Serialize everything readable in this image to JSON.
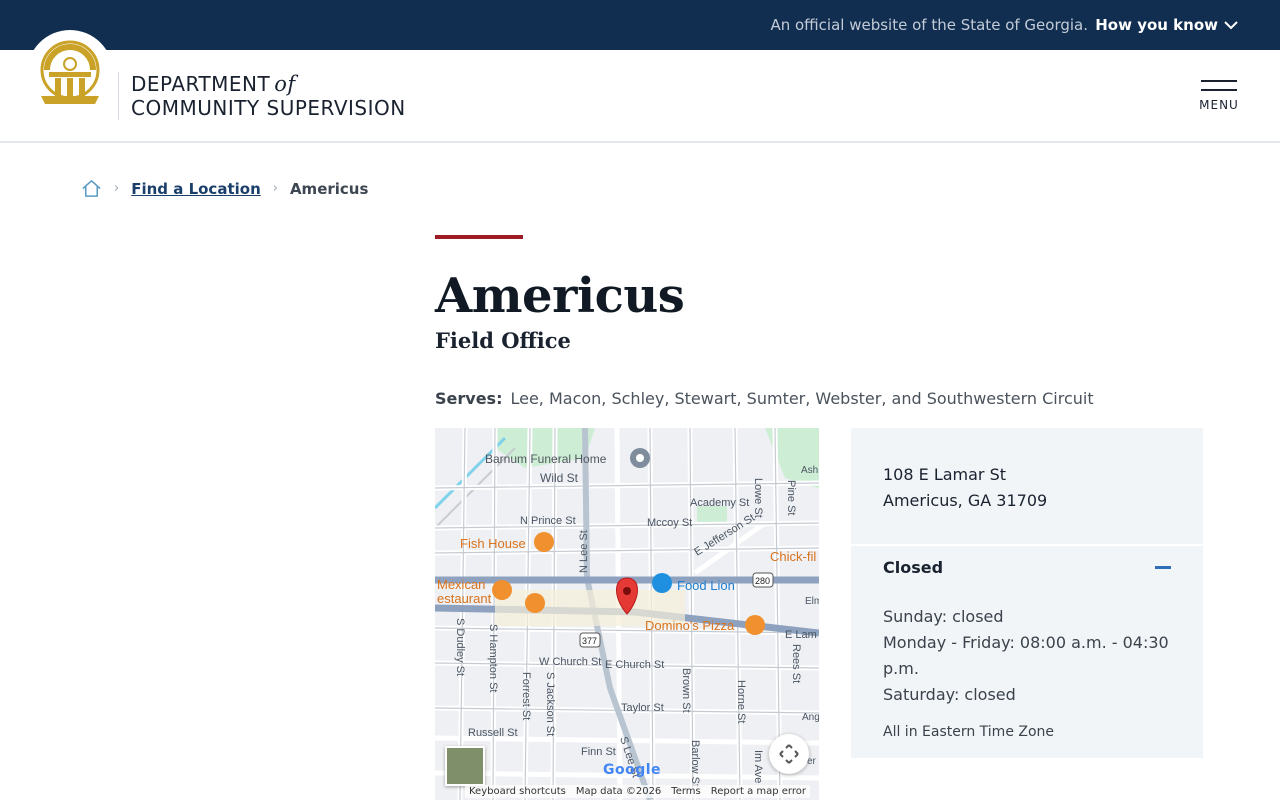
{
  "topbar": {
    "official_text": "An official website of the State of Georgia.",
    "how_you_know": "How you know"
  },
  "header": {
    "brand_line1": "DEPARTMENT",
    "brand_of": "of",
    "brand_line2": "COMMUNITY SUPERVISION",
    "menu_label": "MENU"
  },
  "breadcrumb": {
    "items": [
      {
        "label": "Find a Location"
      },
      {
        "label": "Americus"
      }
    ]
  },
  "page": {
    "title": "Americus",
    "subtitle": "Field Office",
    "serves_label": "Serves:",
    "serves_value": "Lee, Macon, Schley, Stewart, Sumter, Webster, and Southwestern Circuit"
  },
  "map": {
    "labels": {
      "barnum": "Barnum Funeral Home",
      "wild": "Wild St",
      "academy": "Academy St",
      "lowe": "Lowe St",
      "pine": "Pine St",
      "ash": "Ash",
      "nprince": "N Prince St",
      "mccoy": "Mccoy St",
      "nlee": "N Lee St",
      "ejefferson": "E Jefferson St",
      "fishhouse": "Fish House",
      "chickfil": "Chick-fil",
      "mexican1": "Mexican",
      "mexican2": "estaurant",
      "foodlion": "Food Lion",
      "elm": "Elm",
      "dominos": "Domino's Pizza",
      "elam": "E Lam",
      "route280": "280",
      "route377": "377",
      "sdudley": "S Dudley St",
      "shampton": "S Hampton St",
      "wchurch": "W Church St",
      "echurch": "E Church St",
      "forrest": "Forrest St",
      "sjackson": "S Jackson St",
      "brown": "Brown St",
      "horne": "Horne St",
      "rees": "Rees St",
      "taylor": "Taylor St",
      "russell": "Russell St",
      "finn": "Finn St",
      "slee": "S Lee St",
      "barlow": "Barlow St",
      "imave": "Im Ave",
      "ang": "Ang",
      "ver": "ver"
    },
    "google": "Google",
    "footer": {
      "shortcuts": "Keyboard shortcuts",
      "mapdata": "Map data ©2026",
      "terms": "Terms",
      "report": "Report a map error"
    }
  },
  "location": {
    "address_line1": "108 E Lamar St",
    "address_line2": "Americus, GA 31709",
    "status": "Closed",
    "hours": [
      "Sunday: closed",
      "Monday - Friday: 08:00 a.m. - 04:30 p.m.",
      "Saturday: closed"
    ],
    "timezone": "All in Eastern Time Zone"
  },
  "colors": {
    "topbar": "#112e51",
    "accent_red": "#9e1b24",
    "link_blue": "#1b3f6b",
    "seal_gold": "#c9a227"
  }
}
